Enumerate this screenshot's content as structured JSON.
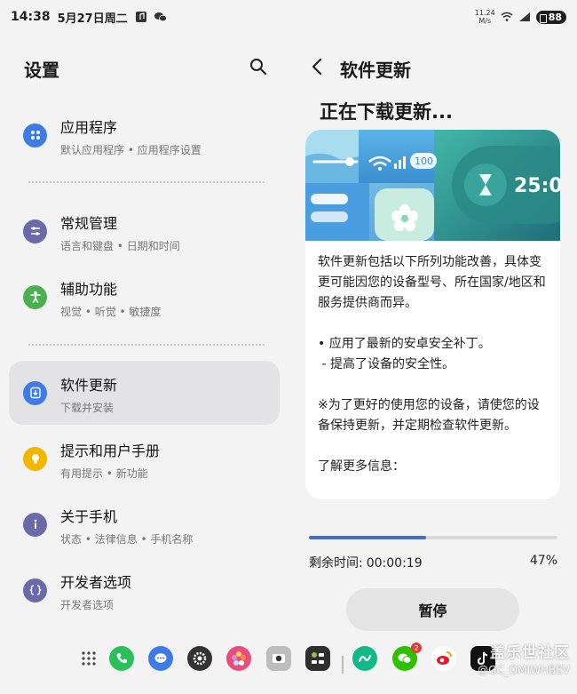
{
  "status_bar": {
    "time": "14:38",
    "date": "5月27日周二",
    "net_speed_value": "11.24",
    "net_speed_unit": "M/s",
    "battery": "88"
  },
  "settings": {
    "title": "设置",
    "items": [
      {
        "title": "应用程序",
        "subtitle": "默认应用程序 • 应用程序设置",
        "icon": "apps-icon",
        "color": "#3d7be8"
      },
      {
        "title": "常规管理",
        "subtitle": "语言和键盘 • 日期和时间",
        "icon": "sliders-icon",
        "color": "#6a6aa8"
      },
      {
        "title": "辅助功能",
        "subtitle": "视觉 • 听觉 • 敏捷度",
        "icon": "accessibility-icon",
        "color": "#4caf50"
      },
      {
        "title": "软件更新",
        "subtitle": "下载并安装",
        "icon": "download-icon",
        "color": "#3d7be8"
      },
      {
        "title": "提示和用户手册",
        "subtitle": "有用提示 • 新功能",
        "icon": "bulb-icon",
        "color": "#f2b600"
      },
      {
        "title": "关于手机",
        "subtitle": "状态 • 法律信息 • 手机名称",
        "icon": "info-icon",
        "color": "#6a6aa8"
      },
      {
        "title": "开发者选项",
        "subtitle": "开发者选项",
        "icon": "code-icon",
        "color": "#6a6aa8"
      }
    ]
  },
  "update": {
    "page_title": "软件更新",
    "heading": "正在下载更新...",
    "banner_wifi_badge": "100",
    "banner_timer": "25:0",
    "description": [
      "软件更新包括以下所列功能改善，具体变更可能因您的设备型号、所在国家/地区和服务提供商而异。",
      "• 应用了最新的安卓安全补丁。",
      " - 提高了设备的安全性。",
      "※为了更好的使用您的设备，请使您的设备保持更新，并定期检查软件更新。",
      "了解更多信息："
    ],
    "progress": 0.47,
    "remaining_label": "剩余时间:",
    "remaining_time": "00:00:19",
    "percent": "47%",
    "pause_label": "暂停"
  },
  "dock": {
    "items": [
      "apps-grid-icon",
      "phone-icon",
      "messages-icon",
      "settings-icon",
      "gallery-icon",
      "camera-icon",
      "calculator-icon",
      "link-app-icon",
      "wechat-icon",
      "weibo-icon",
      "tiktok-icon"
    ],
    "wechat_badge": "2",
    "watermark_line1": "盖乐世社区",
    "watermark_line2": "@GC_OMIWHBEV"
  },
  "colors": {
    "accent": "#3f6fcf",
    "active_item_bg": "#e3e3e6",
    "background": "#f3f3f3"
  }
}
